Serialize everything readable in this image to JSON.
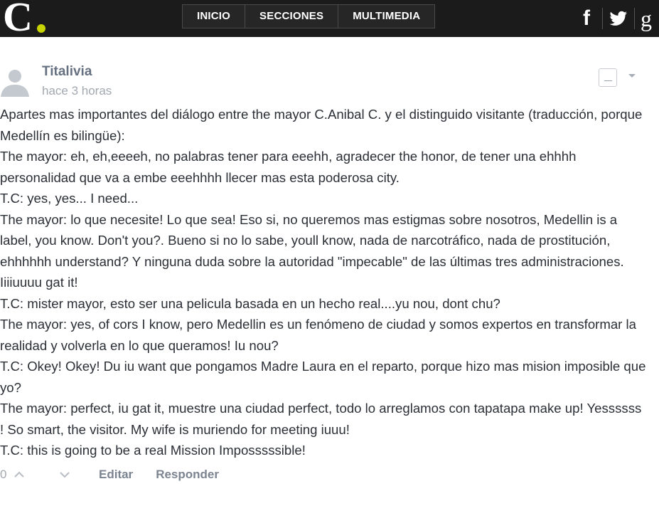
{
  "header": {
    "logo_letter": "C",
    "logo_dot_color": "#c8d400",
    "nav": [
      {
        "label": "INICIO"
      },
      {
        "label": "SECCIONES"
      },
      {
        "label": "MULTIMEDIA"
      }
    ],
    "social": {
      "facebook_glyph": "f",
      "google_glyph": "g"
    }
  },
  "comment": {
    "author": "Titalivia",
    "time": "hace 3 horas",
    "lines": [
      "Apartes mas importantes del diálogo entre the mayor C.Anibal C. y el distinguido visitante (traducción, porque Medellín es bilingüe):",
      "The mayor: eh, eh,eeeeh, no palabras tener para eeehh, agradecer the honor, de tener una ehhhh personalidad que va a embe eeehhhh llecer mas esta poderosa city.",
      "T.C: yes, yes... I need...",
      "The mayor: lo que necesite! Lo que sea! Eso si, no queremos mas estigmas sobre nosotros, Medellin is a label, you know. Don't you?. Bueno si no lo sabe, youll know, nada de narcotráfico, nada de prostitución, ehhhhhh understand? Y ninguna duda sobre la autoridad \"impecable\" de las últimas tres administraciones. Iiiiuuuu gat it!",
      "T.C: mister mayor, esto ser una pelicula basada en un hecho real....yu nou, dont chu?",
      "The mayor: yes, of cors I know, pero Medellin es un fenómeno de ciudad y somos expertos en transformar la realidad y volverla en lo que queramos! Iu nou?",
      "T.C: Okey! Okey! Du iu want que pongamos Madre Laura en el reparto, porque hizo mas mision imposible que yo?",
      "The mayor: perfect, iu gat it, muestre una ciudad perfect, todo lo arreglamos con tapatapa make up! Yessssss ! So smart, the visitor. My wife is muriendo for meeting iuuu!",
      "T.C: this is going to be a real Mission Imposssssible!"
    ],
    "votes": "0",
    "edit_label": "Editar",
    "reply_label": "Responder"
  },
  "colors": {
    "topbar": "#1b1b1b",
    "author": "#657080",
    "meta": "#a2a8b0",
    "text": "#2b2f36"
  }
}
